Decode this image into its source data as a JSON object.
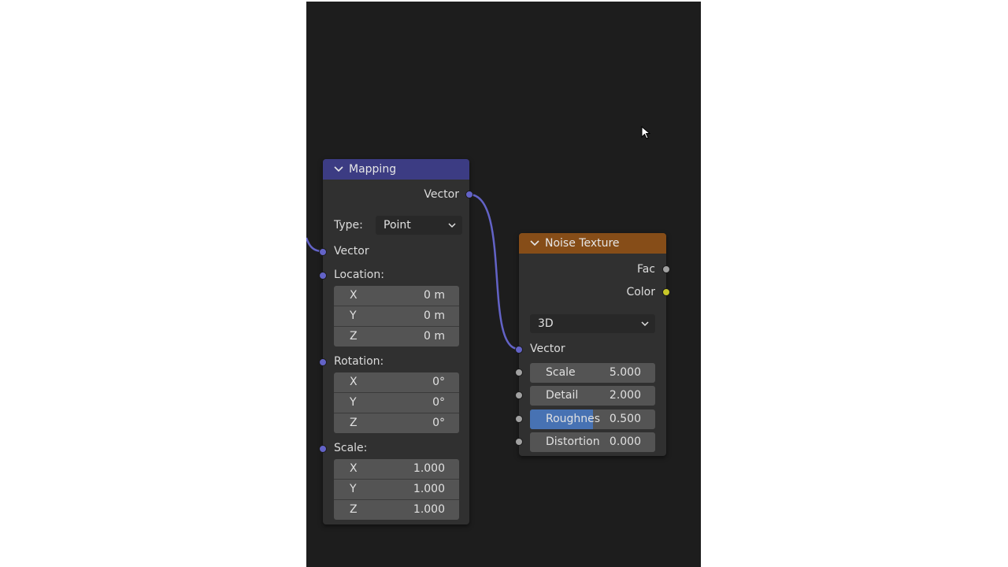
{
  "colors": {
    "mapping_header": "#3c3c83",
    "noise_header": "#864d18",
    "vector_socket": "#6363c7",
    "float_socket": "#a1a1a1",
    "color_socket": "#c7c729",
    "field_bg": "#545454",
    "slider_fill": "#4772b3",
    "link": "#6363c7"
  },
  "mapping_node": {
    "title": "Mapping",
    "collapse_icon": "chevron-down-icon",
    "output_vector": "Vector",
    "type_label": "Type:",
    "type_value": "Point",
    "input_vector": "Vector",
    "location_label": "Location:",
    "location": [
      {
        "axis": "X",
        "value": "0 m"
      },
      {
        "axis": "Y",
        "value": "0 m"
      },
      {
        "axis": "Z",
        "value": "0 m"
      }
    ],
    "rotation_label": "Rotation:",
    "rotation": [
      {
        "axis": "X",
        "value": "0°"
      },
      {
        "axis": "Y",
        "value": "0°"
      },
      {
        "axis": "Z",
        "value": "0°"
      }
    ],
    "scale_label": "Scale:",
    "scale": [
      {
        "axis": "X",
        "value": "1.000"
      },
      {
        "axis": "Y",
        "value": "1.000"
      },
      {
        "axis": "Z",
        "value": "1.000"
      }
    ]
  },
  "noise_node": {
    "title": "Noise Texture",
    "collapse_icon": "chevron-down-icon",
    "output_fac": "Fac",
    "output_color": "Color",
    "dimension_value": "3D",
    "input_vector": "Vector",
    "inputs": [
      {
        "label": "Scale",
        "value": "5.000"
      },
      {
        "label": "Detail",
        "value": "2.000"
      },
      {
        "label": "Roughnes",
        "value": "0.500",
        "fill_fraction": 0.5
      },
      {
        "label": "Distortion",
        "value": "0.000"
      }
    ]
  },
  "cursor_icon": "mouse-pointer-icon"
}
